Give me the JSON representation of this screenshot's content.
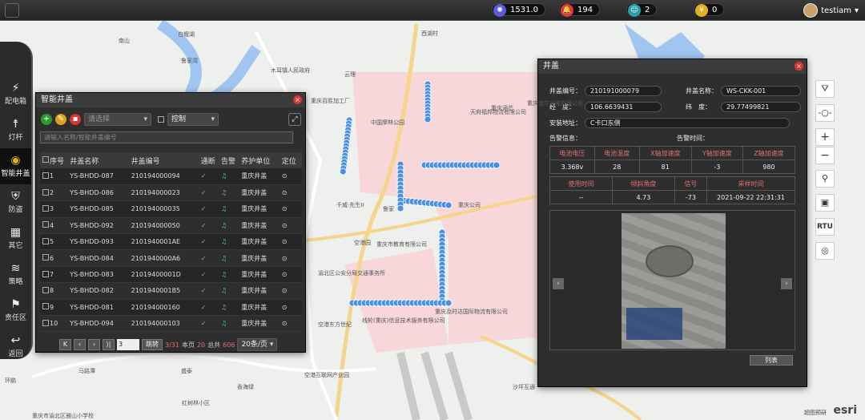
{
  "topbar": {
    "stats": [
      {
        "icon": "star-icon",
        "value": "1531.0",
        "color": "#5a5adb"
      },
      {
        "icon": "bell-icon",
        "value": "194",
        "color": "#e03a3a"
      },
      {
        "icon": "person-icon",
        "value": "2",
        "color": "#2a9fa8"
      },
      {
        "icon": "coin-icon",
        "value": "0",
        "color": "#e0b020"
      }
    ],
    "username": "testiam"
  },
  "sidebar": {
    "items": [
      {
        "icon": "power-icon",
        "label": "配电箱"
      },
      {
        "icon": "lamp-icon",
        "label": "灯杆"
      },
      {
        "icon": "manhole-icon",
        "label": "智能井盖"
      },
      {
        "icon": "shield-icon",
        "label": "防盗"
      },
      {
        "icon": "grid-icon",
        "label": "其它"
      },
      {
        "icon": "layers-icon",
        "label": "策略"
      },
      {
        "icon": "flag-icon",
        "label": "责任区"
      },
      {
        "icon": "back-icon",
        "label": "返回"
      }
    ]
  },
  "list_panel": {
    "title": "智能井盖",
    "select_placeholder": "请选择",
    "control_label": "控制",
    "search_placeholder": "请输入名称/智能井盖编号",
    "columns": [
      "序号",
      "井盖名称",
      "井盖编号",
      "通断",
      "告警",
      "养护单位",
      "定位"
    ],
    "rows": [
      {
        "no": "1",
        "name": "YS-BHDD-087",
        "code": "210194000094",
        "unit": "重庆井盖"
      },
      {
        "no": "2",
        "name": "YS-BHDD-086",
        "code": "210194000023",
        "unit": "重庆井盖"
      },
      {
        "no": "3",
        "name": "YS-BHDD-085",
        "code": "210194000035",
        "unit": "重庆井盖"
      },
      {
        "no": "4",
        "name": "YS-BHDD-092",
        "code": "210194000050",
        "unit": "重庆井盖"
      },
      {
        "no": "5",
        "name": "YS-BHDD-093",
        "code": "2101940001AE",
        "unit": "重庆井盖"
      },
      {
        "no": "6",
        "name": "YS-BHDD-084",
        "code": "2101940000A6",
        "unit": "重庆井盖"
      },
      {
        "no": "7",
        "name": "YS-BHDD-083",
        "code": "21019400001D",
        "unit": "重庆井盖"
      },
      {
        "no": "8",
        "name": "YS-BHDD-082",
        "code": "2101940001B5",
        "unit": "重庆井盖"
      },
      {
        "no": "9",
        "name": "YS-BHDD-081",
        "code": "210194000160",
        "unit": "重庆井盖"
      },
      {
        "no": "10",
        "name": "YS-BHDD-094",
        "code": "210194000103",
        "unit": "重庆井盖"
      }
    ],
    "pager": {
      "current_page": "3",
      "go_label": "跳转",
      "page_info": "3/31",
      "this_page_label": "本页",
      "this_page_count": "20",
      "total_label": "总共",
      "total_count": "606",
      "per_page": "20条/页"
    }
  },
  "detail_panel": {
    "title": "井盖",
    "fields": {
      "code_label": "井盖编号：",
      "code": "210191000079",
      "name_label": "井盖名称：",
      "name": "WS-CKK-001",
      "lng_label": "经　度：",
      "lng": "106.6639431",
      "lat_label": "纬　度：",
      "lat": "29.77499821",
      "addr_label": "安装地址：",
      "addr": "C卡口东侧"
    },
    "alarm_info_label": "告警信息：",
    "alarm_time_label": "告警时间：",
    "sensor_headers": [
      "电池电压",
      "电池温度",
      "X轴加速度",
      "Y轴加速度",
      "Z轴加速度"
    ],
    "sensor_values": [
      "3.368v",
      "28",
      "81",
      "-3",
      "980"
    ],
    "status_headers": [
      "使用时间",
      "倾斜角度",
      "信号",
      "采样时间"
    ],
    "status_values": [
      "--",
      "4.73",
      "-73",
      "2021-09-22 22:31:31"
    ],
    "list_button": "列表"
  },
  "map": {
    "labels": [
      "南山",
      "白蛾湖",
      "木耳镇人民政府",
      "云理",
      "西湖村",
      "鲁家湾",
      "中国摩林公园",
      "重庆百胜加工厂",
      "重庆涵芒",
      "天府福邦物流有限公司",
      "千威·先生II",
      "空港东方世纪",
      "重庆公司",
      "空港园",
      "渝北区公安分局交通事务所",
      "重庆市教育有限公司",
      "重庆及时达国际物流有限公司",
      "线轮(重庆)信息技术服务有限公司",
      "空港互联网产业园",
      "红树林小区",
      "重庆市渝北区雅山小学校",
      "香海绿",
      "马路潭",
      "沙坪互通",
      "环鹏",
      "重庆金牛光电有限公司",
      "鲁家",
      "盛泰"
    ],
    "credit": "超图预研",
    "brand": "esri"
  },
  "colors": {
    "accent": "#4a90e2",
    "panel": "#2e2e2e",
    "alarm": "#e07070"
  }
}
